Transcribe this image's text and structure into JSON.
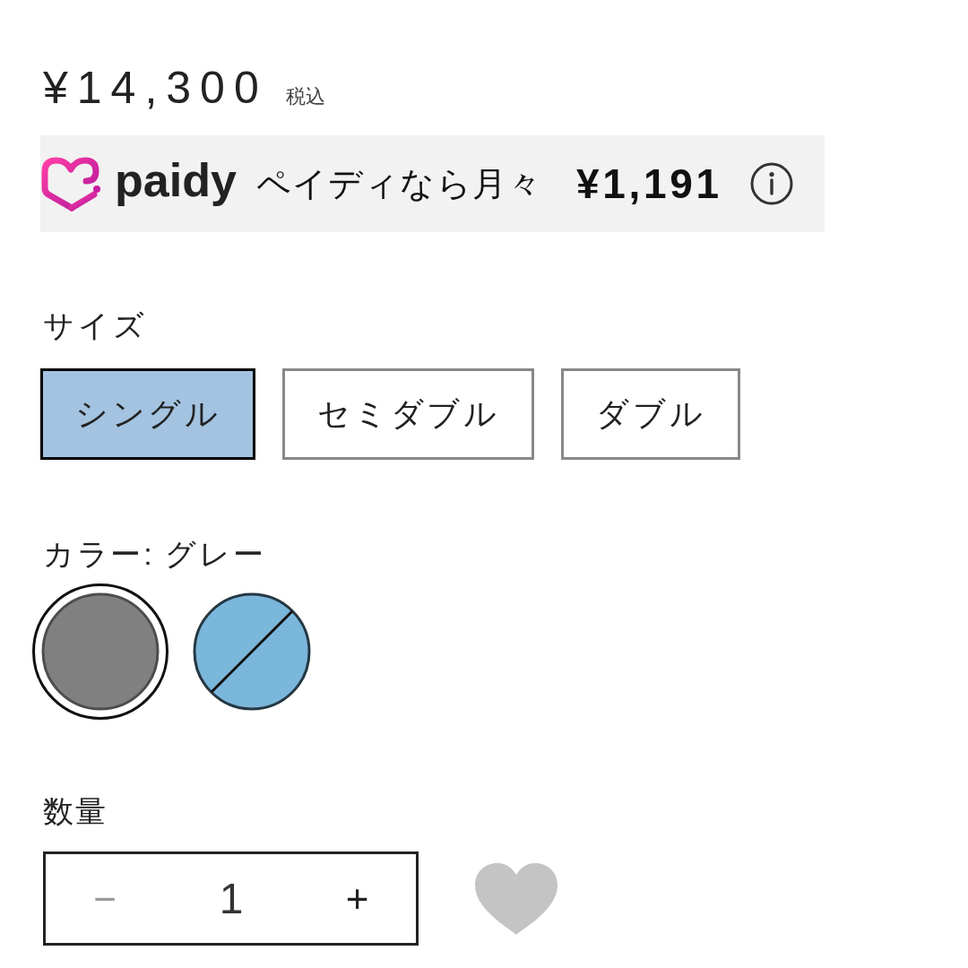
{
  "price": {
    "amount": "¥14,300",
    "tax_note": "税込"
  },
  "paidy_banner": {
    "brand": "paidy",
    "message": "ペイディなら月々",
    "monthly_amount": "¥1,191"
  },
  "size": {
    "label": "サイズ",
    "options": [
      {
        "label": "シングル",
        "selected": true
      },
      {
        "label": "セミダブル",
        "selected": false
      },
      {
        "label": "ダブル",
        "selected": false
      }
    ]
  },
  "color": {
    "label": "カラー: グレー",
    "swatches": [
      {
        "color": "#808080",
        "selected": true,
        "sold_out": false
      },
      {
        "color": "#7bb6db",
        "selected": false,
        "sold_out": true
      }
    ]
  },
  "quantity": {
    "label": "数量",
    "value": "1",
    "decrease_button": {
      "label": "−",
      "disabled": true
    },
    "increase_button": {
      "label": "+",
      "disabled": false
    }
  },
  "favorite": {
    "selected": false
  }
}
